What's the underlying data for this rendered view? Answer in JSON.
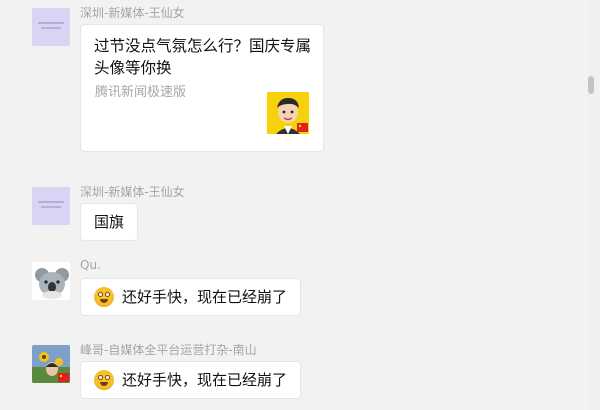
{
  "messages": [
    {
      "sender": "深圳-新媒体-王仙女",
      "card": {
        "title": "过节没点气氛怎么行？国庆专属头像等你换",
        "source": "腾讯新闻极速版"
      }
    },
    {
      "sender": "深圳-新媒体-王仙女",
      "text": "国旗"
    },
    {
      "sender": "Qu.",
      "emoji": "grinning-face-icon",
      "text": "还好手快，现在已经崩了"
    },
    {
      "sender": "峰哥-自媒体全平台运营打杂-南山",
      "emoji": "grinning-face-icon",
      "text": "还好手快，现在已经崩了"
    }
  ],
  "colors": {
    "background": "#f2f2f2",
    "bubble": "#ffffff",
    "sender_text": "#a4a4a4",
    "avatar_lavender": "#d9d3f4",
    "thumb_yellow": "#f6d20a"
  }
}
